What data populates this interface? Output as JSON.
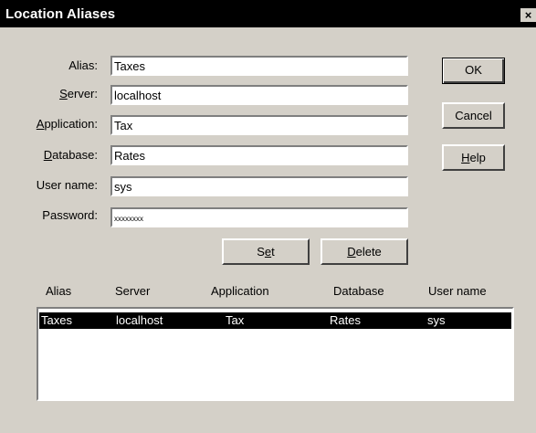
{
  "window": {
    "title": "Location Aliases",
    "close_label": "×"
  },
  "form": {
    "alias_label": "Alias:",
    "alias_value": "Taxes",
    "server_label_pre": "",
    "server_label_key": "S",
    "server_label_post": "erver:",
    "server_value": "localhost",
    "application_label_key": "A",
    "application_label_post": "pplication:",
    "application_value": "Tax",
    "database_label_key": "D",
    "database_label_post": "atabase:",
    "database_value": "Rates",
    "username_label": "User name:",
    "username_value": "sys",
    "password_label": "Password:",
    "password_value": "xxxxxxxx"
  },
  "buttons": {
    "ok": "OK",
    "cancel": "Cancel",
    "help_key": "H",
    "help_post": "elp",
    "set_pre": "S",
    "set_key": "e",
    "set_post": "t",
    "delete_key": "D",
    "delete_post": "elete"
  },
  "list": {
    "columns": [
      "Alias",
      "Server",
      "Application",
      "Database",
      "User name"
    ],
    "rows": [
      {
        "alias": "Taxes",
        "server": "localhost",
        "application": "Tax",
        "database": "Rates",
        "username": "sys"
      }
    ]
  }
}
